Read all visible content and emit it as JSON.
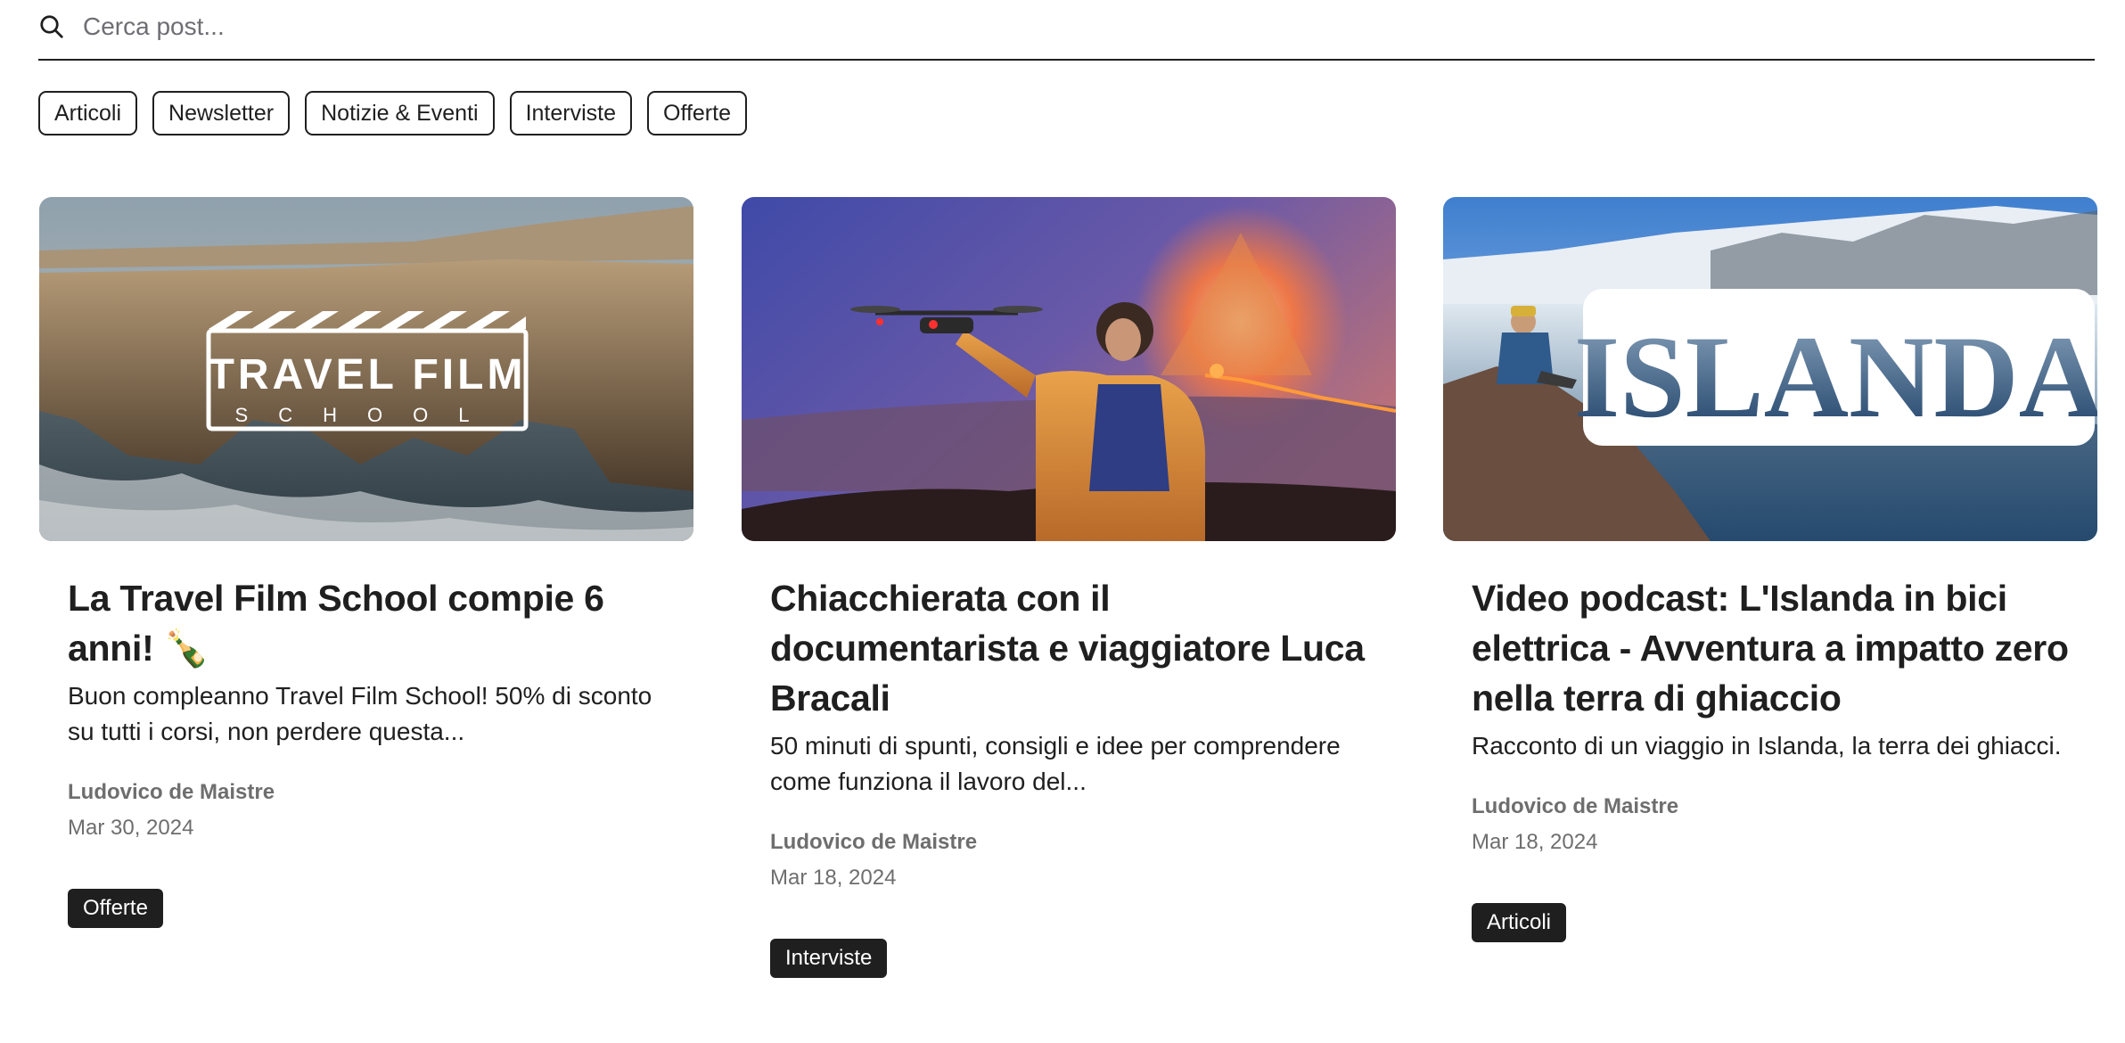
{
  "search": {
    "placeholder": "Cerca post..."
  },
  "filters": [
    {
      "label": "Articoli"
    },
    {
      "label": "Newsletter"
    },
    {
      "label": "Notizie & Eventi"
    },
    {
      "label": "Interviste"
    },
    {
      "label": "Offerte"
    }
  ],
  "posts": [
    {
      "title": "La Travel Film School compie 6 anni! 🍾",
      "excerpt": "Buon compleanno Travel Film School! 50% di sconto su tutti i corsi, non perdere questa...",
      "author": "Ludovico de Maistre",
      "date": "Mar 30, 2024",
      "tag": "Offerte",
      "image_text": {
        "line1": "TRAVEL FILM",
        "line2": "SCHOOL"
      }
    },
    {
      "title": "Chiacchierata con il documentarista e viaggiatore Luca Bracali",
      "excerpt": "50 minuti di spunti, consigli e idee per comprendere come funziona il lavoro del...",
      "author": "Ludovico de Maistre",
      "date": "Mar 18, 2024",
      "tag": "Interviste"
    },
    {
      "title": "Video podcast: L'Islanda in bici elettrica - Avventura a impatto zero nella terra di ghiaccio",
      "excerpt": "Racconto di un viaggio in Islanda, la terra dei ghiacci.",
      "author": "Ludovico de Maistre",
      "date": "Mar 18, 2024",
      "tag": "Articoli",
      "image_text": {
        "word": "ISLANDA"
      }
    }
  ],
  "icons": {
    "search": "search-icon"
  },
  "colors": {
    "text": "#1f1f1f",
    "muted": "#6e6e6e",
    "tag_bg": "#1f1f1f",
    "tag_text": "#ffffff"
  }
}
